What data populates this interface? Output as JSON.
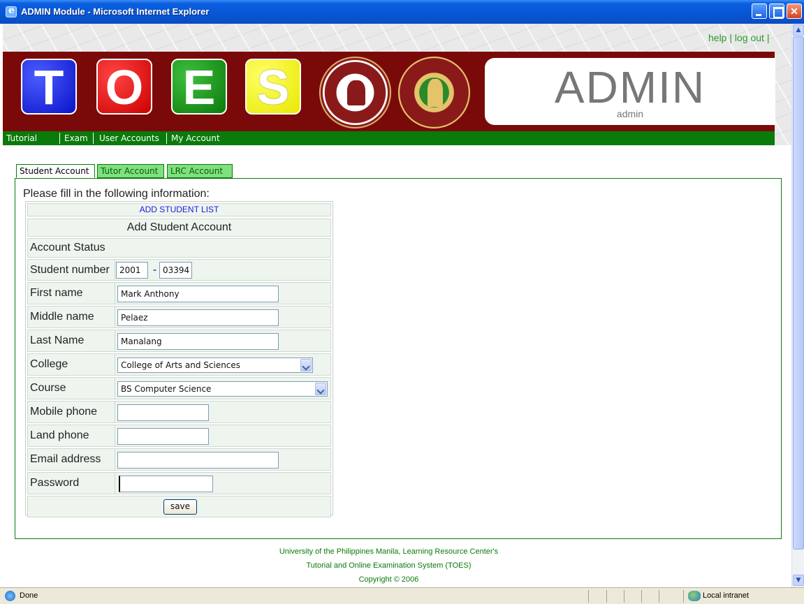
{
  "window": {
    "title": "ADMIN Module - Microsoft Internet Explorer"
  },
  "top_links": {
    "help": "help",
    "logout": "log out"
  },
  "banner": {
    "tiles": [
      "T",
      "O",
      "E",
      "S"
    ],
    "admin_title": "ADMIN",
    "admin_user": "admin"
  },
  "nav": [
    "Tutorial",
    "Exam",
    "User Accounts",
    "My Account"
  ],
  "tabs": [
    "Student Account",
    "Tutor Account",
    "LRC Account"
  ],
  "form": {
    "instruction": "Please fill in the following information:",
    "add_list_link": "ADD STUDENT LIST",
    "heading": "Add Student Account",
    "labels": {
      "status": "Account Status",
      "student_number": "Student number",
      "first_name": "First name",
      "middle_name": "Middle name",
      "last_name": "Last Name",
      "college": "College",
      "course": "Course",
      "mobile": "Mobile phone",
      "land": "Land phone",
      "email": "Email address",
      "password": "Password"
    },
    "values": {
      "student_number_year": "2001",
      "student_number_dash": "-",
      "student_number_seq": "03394",
      "first_name": "Mark Anthony",
      "middle_name": "Pelaez",
      "last_name": "Manalang",
      "college": "College of Arts and Sciences",
      "course": "BS Computer Science",
      "mobile": "",
      "land": "",
      "email": "",
      "password": ""
    },
    "save_label": "save"
  },
  "footer": {
    "line1": "University of the Philippines Manila, Learning Resource Center's",
    "line2": "Tutorial and Online Examination System (TOES)",
    "line3": "Copyright © 2006"
  },
  "statusbar": {
    "status": "Done",
    "zone": "Local intranet"
  }
}
